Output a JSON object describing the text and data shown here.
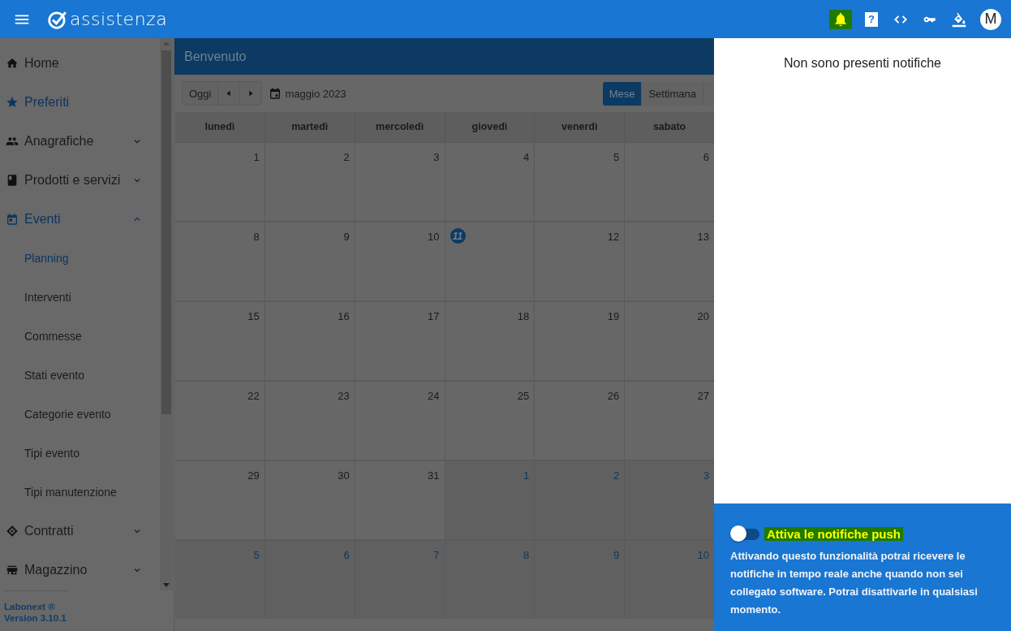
{
  "topbar": {
    "app_name": "assistenza",
    "actions": [
      {
        "kind": "bell",
        "highlighted": true
      },
      {
        "kind": "help",
        "highlighted": false,
        "glyph": "?"
      },
      {
        "kind": "code",
        "highlighted": false
      },
      {
        "kind": "key",
        "highlighted": false
      },
      {
        "kind": "paint",
        "highlighted": false
      }
    ],
    "avatar": "M"
  },
  "sidebar": {
    "items": [
      {
        "label": "Home"
      },
      {
        "label": "Preferiti"
      },
      {
        "label": "Anagrafiche",
        "expanded": false
      },
      {
        "label": "Prodotti e servizi",
        "expanded": false
      },
      {
        "label": "Eventi",
        "expanded": true,
        "children": [
          {
            "label": "Planning",
            "selected": true
          },
          {
            "label": "Interventi",
            "selected": false
          },
          {
            "label": "Commesse",
            "selected": false
          },
          {
            "label": "Stati evento",
            "selected": false
          },
          {
            "label": "Categorie evento",
            "selected": false
          },
          {
            "label": "Tipi evento",
            "selected": false
          },
          {
            "label": "Tipi manutenzione",
            "selected": false
          }
        ]
      },
      {
        "label": "Contratti",
        "expanded": false
      },
      {
        "label": "Magazzino",
        "expanded": false
      }
    ],
    "footer": {
      "brand": "Labonext ®",
      "version": "Version 3.10.1"
    }
  },
  "page": {
    "title": "Benvenuto",
    "today_button": "Oggi",
    "month": "maggio 2023",
    "views": [
      {
        "label": "Mese",
        "selected": true
      },
      {
        "label": "Settimana",
        "selected": false
      }
    ],
    "weekdays": [
      "lunedì",
      "martedì",
      "mercoledì",
      "giovedì",
      "venerdì",
      "sabato"
    ],
    "weeks": [
      [
        {
          "day": "1",
          "other_month": false,
          "today": false
        },
        {
          "day": "2",
          "other_month": false,
          "today": false
        },
        {
          "day": "3",
          "other_month": false,
          "today": false
        },
        {
          "day": "4",
          "other_month": false,
          "today": false
        },
        {
          "day": "5",
          "other_month": false,
          "today": false
        },
        {
          "day": "6",
          "other_month": false,
          "today": false
        }
      ],
      [
        {
          "day": "8",
          "other_month": false,
          "today": false
        },
        {
          "day": "9",
          "other_month": false,
          "today": false
        },
        {
          "day": "10",
          "other_month": false,
          "today": false
        },
        {
          "day": "11",
          "other_month": false,
          "today": true
        },
        {
          "day": "12",
          "other_month": false,
          "today": false
        },
        {
          "day": "13",
          "other_month": false,
          "today": false
        }
      ],
      [
        {
          "day": "15",
          "other_month": false,
          "today": false
        },
        {
          "day": "16",
          "other_month": false,
          "today": false
        },
        {
          "day": "17",
          "other_month": false,
          "today": false
        },
        {
          "day": "18",
          "other_month": false,
          "today": false
        },
        {
          "day": "19",
          "other_month": false,
          "today": false
        },
        {
          "day": "20",
          "other_month": false,
          "today": false
        }
      ],
      [
        {
          "day": "22",
          "other_month": false,
          "today": false
        },
        {
          "day": "23",
          "other_month": false,
          "today": false
        },
        {
          "day": "24",
          "other_month": false,
          "today": false
        },
        {
          "day": "25",
          "other_month": false,
          "today": false
        },
        {
          "day": "26",
          "other_month": false,
          "today": false
        },
        {
          "day": "27",
          "other_month": false,
          "today": false
        }
      ],
      [
        {
          "day": "29",
          "other_month": false,
          "today": false
        },
        {
          "day": "30",
          "other_month": false,
          "today": false
        },
        {
          "day": "31",
          "other_month": false,
          "today": false
        },
        {
          "day": "1",
          "other_month": true,
          "today": false
        },
        {
          "day": "2",
          "other_month": true,
          "today": false
        },
        {
          "day": "3",
          "other_month": true,
          "today": false
        }
      ],
      [
        {
          "day": "5",
          "other_month": true,
          "today": false
        },
        {
          "day": "6",
          "other_month": true,
          "today": false
        },
        {
          "day": "7",
          "other_month": true,
          "today": false
        },
        {
          "day": "8",
          "other_month": true,
          "today": false
        },
        {
          "day": "9",
          "other_month": true,
          "today": false
        },
        {
          "day": "10",
          "other_month": true,
          "today": false
        }
      ]
    ]
  },
  "notifications": {
    "empty_text": "Non sono presenti notifiche",
    "push": {
      "on": false,
      "label": "Attiva le notifiche push",
      "highlighted": true,
      "description": "Attivando questo funzionalità potrai ricevere le notifiche in tempo reale anche quando non sei collegato software. Potrai disattivarle in qualsiasi momento."
    }
  }
}
